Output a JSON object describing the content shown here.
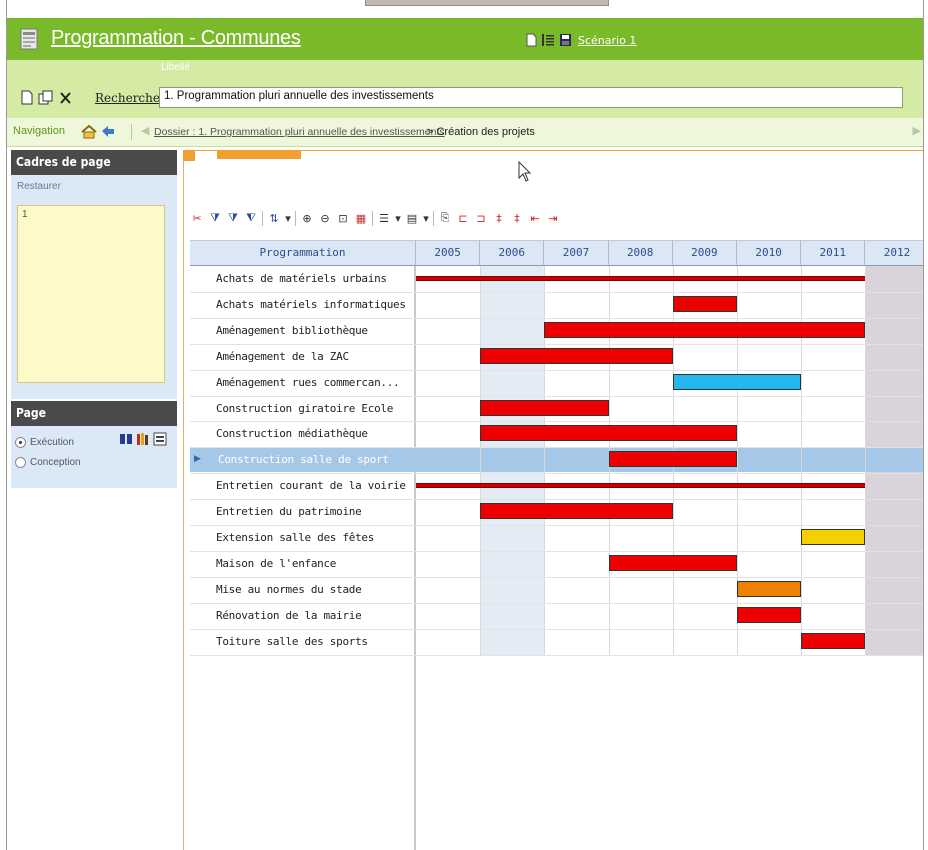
{
  "app": {
    "title": "Programmation - Communes",
    "scenario_link": "Scénario 1"
  },
  "search": {
    "libelle_label": "Libellé",
    "recherche_link": "Recherche",
    "value": "1. Programmation pluri annuelle des investissements"
  },
  "navigation": {
    "label": "Navigation",
    "crumb_link": "Dossier : 1. Programmation pluri annuelle des investissements",
    "crumb_current": "> Création des projets"
  },
  "left_panel": {
    "cadres_header": "Cadres de page",
    "restaurer": "Restaurer",
    "frame_items": [
      "1"
    ],
    "page_header": "Page",
    "radios": [
      {
        "label": "Exécution",
        "checked": true
      },
      {
        "label": "Conception",
        "checked": false
      }
    ]
  },
  "gantt": {
    "name_header": "Programmation",
    "years": [
      "2005",
      "2006",
      "2007",
      "2008",
      "2009",
      "2010",
      "2011",
      "2012"
    ],
    "selected_row": 7,
    "projects": [
      {
        "name": "Achats de matériels urbains",
        "start": 2005,
        "end": 2012,
        "style": "thin",
        "color": "#cc0000"
      },
      {
        "name": "Achats matériels informatiques",
        "start": 2009,
        "end": 2010,
        "style": "bar",
        "color": "#ee0000"
      },
      {
        "name": "Aménagement bibliothèque",
        "start": 2007,
        "end": 2012,
        "style": "bar",
        "color": "#ee0000"
      },
      {
        "name": "Aménagement de la ZAC",
        "start": 2006,
        "end": 2009,
        "style": "bar",
        "color": "#ee0000"
      },
      {
        "name": "Aménagement rues commercan...",
        "start": 2009,
        "end": 2011,
        "style": "bar",
        "color": "#22b8ee"
      },
      {
        "name": "Construction giratoire Ecole",
        "start": 2006,
        "end": 2008,
        "style": "bar",
        "color": "#ee0000"
      },
      {
        "name": "Construction médiathèque",
        "start": 2006,
        "end": 2010,
        "style": "bar",
        "color": "#ee0000"
      },
      {
        "name": "Construction salle de sport",
        "start": 2008,
        "end": 2010,
        "style": "bar",
        "color": "#ee0000"
      },
      {
        "name": "Entretien courant de la voirie",
        "start": 2005,
        "end": 2012,
        "style": "thin",
        "color": "#cc0000"
      },
      {
        "name": "Entretien du patrimoine",
        "start": 2006,
        "end": 2009,
        "style": "bar",
        "color": "#ee0000"
      },
      {
        "name": "Extension salle des fêtes",
        "start": 2011,
        "end": 2012,
        "style": "bar",
        "color": "#f5d000"
      },
      {
        "name": "Maison de l'enfance",
        "start": 2008,
        "end": 2010,
        "style": "bar",
        "color": "#ee0000"
      },
      {
        "name": "Mise au normes du stade",
        "start": 2010,
        "end": 2011,
        "style": "bar",
        "color": "#f08000"
      },
      {
        "name": "Rénovation de la mairie",
        "start": 2010,
        "end": 2011,
        "style": "bar",
        "color": "#ee0000"
      },
      {
        "name": "Toiture salle des sports",
        "start": 2011,
        "end": 2012,
        "style": "bar",
        "color": "#ee0000"
      }
    ]
  },
  "colors": {
    "title_bar": "#7ab929",
    "search_bar": "#d5eba4",
    "highlight_2006": "#e3ebf5",
    "shaded_2012": "#d8d4da",
    "selection": "#a6c8e8"
  }
}
